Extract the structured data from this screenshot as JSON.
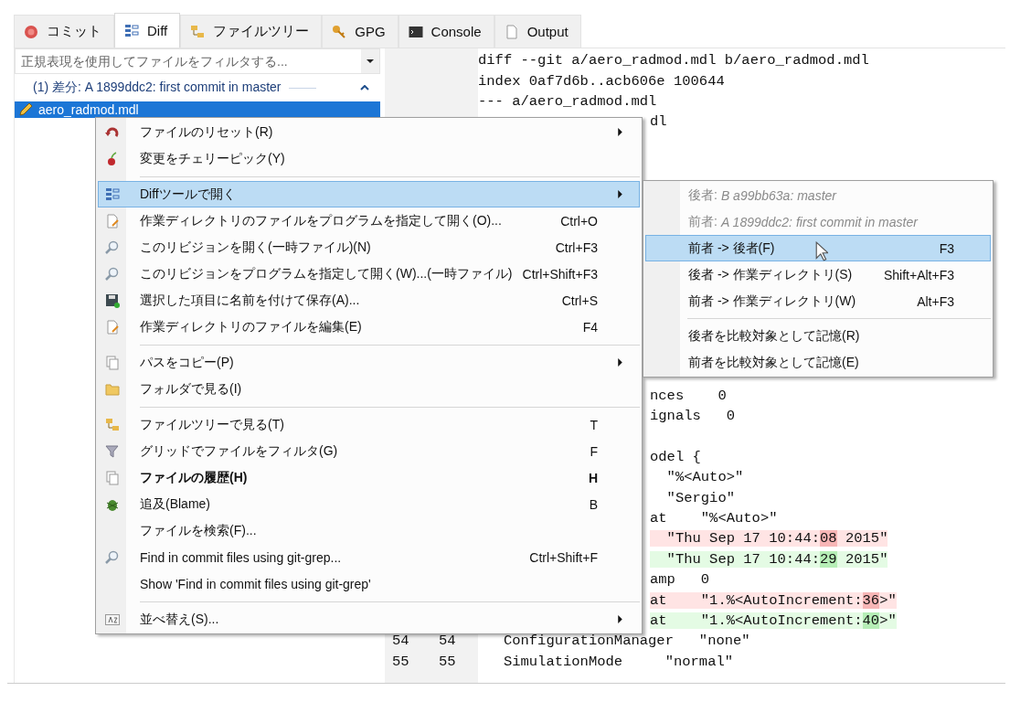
{
  "tabs": [
    {
      "label": "コミット",
      "selected": false
    },
    {
      "label": "Diff",
      "selected": true
    },
    {
      "label": "ファイルツリー",
      "selected": false
    },
    {
      "label": "GPG",
      "selected": false
    },
    {
      "label": "Console",
      "selected": false
    },
    {
      "label": "Output",
      "selected": false
    }
  ],
  "file_panel": {
    "filter": {
      "placeholder": "正規表現を使用してファイルをフィルタする..."
    },
    "group": {
      "label": "(1) 差分: A 1899ddc2: first commit in master",
      "expanded": true
    },
    "files": [
      {
        "name": "aero_radmod.mdl",
        "selected": true
      }
    ]
  },
  "diff": {
    "top_lines": [
      {
        "kind": "context",
        "clipped": false,
        "text": "diff --git a/aero_radmod.mdl b/aero_radmod.mdl"
      },
      {
        "kind": "context",
        "clipped": false,
        "text": "index 0af7d6b..acb606e 100644"
      },
      {
        "kind": "context",
        "clipped": false,
        "text": "--- a/aero_radmod.mdl"
      },
      {
        "kind": "context",
        "clipped": true,
        "text": "dl"
      }
    ],
    "middle_lines": [
      {
        "kind": "context",
        "clipped": true,
        "text": "nces    0"
      },
      {
        "kind": "context",
        "clipped": true,
        "text": "ignals   0"
      }
    ],
    "bottom_lines": [
      {
        "kind": "context",
        "clipped": true,
        "text": "odel {"
      },
      {
        "kind": "context",
        "clipped": true,
        "text": "  \"%<Auto>\""
      },
      {
        "kind": "context",
        "clipped": true,
        "text": "  \"Sergio\""
      },
      {
        "kind": "context",
        "clipped": true,
        "text": "at    \"%<Auto>\""
      },
      {
        "kind": "removed",
        "clipped": true,
        "segments": [
          {
            "text": "  \"Thu Sep 17 10:44:",
            "changed": false
          },
          {
            "text": "08",
            "changed": true
          },
          {
            "text": " 2015\"",
            "changed": false
          }
        ]
      },
      {
        "kind": "added",
        "clipped": true,
        "segments": [
          {
            "text": "  \"Thu Sep 17 10:44:",
            "changed": false
          },
          {
            "text": "29",
            "changed": true
          },
          {
            "text": " 2015\"",
            "changed": false
          }
        ]
      },
      {
        "kind": "context",
        "clipped": true,
        "text": "amp   0"
      },
      {
        "kind": "removed",
        "clipped": true,
        "segments": [
          {
            "text": "at    \"1.%<AutoIncrement:",
            "changed": false
          },
          {
            "text": "36",
            "changed": true
          },
          {
            "text": ">\"",
            "changed": false
          }
        ]
      },
      {
        "kind": "added",
        "clipped": true,
        "segments": [
          {
            "text": "at    \"1.%<AutoIncrement:",
            "changed": false
          },
          {
            "text": "40",
            "changed": true
          },
          {
            "text": ">\"",
            "changed": false
          }
        ]
      },
      {
        "kind": "context",
        "clipped": false,
        "old": "54",
        "new": "54",
        "text": "   ConfigurationManager   \"none\""
      },
      {
        "kind": "context",
        "clipped": false,
        "old": "55",
        "new": "55",
        "text": "   SimulationMode     \"normal\""
      }
    ]
  },
  "context_menu": {
    "items": [
      {
        "kind": "item",
        "label": "ファイルのリセット(R)",
        "submenu": true,
        "bold": false,
        "selected": false
      },
      {
        "kind": "item",
        "label": "変更をチェリーピック(Y)",
        "submenu": false,
        "bold": false,
        "selected": false
      },
      {
        "kind": "separator"
      },
      {
        "kind": "item",
        "label": "Diffツールで開く",
        "submenu": true,
        "bold": false,
        "selected": true
      },
      {
        "kind": "item",
        "label": "作業ディレクトリのファイルをプログラムを指定して開く(O)...",
        "shortcut": "Ctrl+O",
        "submenu": false,
        "bold": false,
        "selected": false
      },
      {
        "kind": "item",
        "label": "このリビジョンを開く(一時ファイル)(N)",
        "shortcut": "Ctrl+F3",
        "submenu": false,
        "bold": false,
        "selected": false
      },
      {
        "kind": "item",
        "label": "このリビジョンをプログラムを指定して開く(W)...(一時ファイル)",
        "shortcut": "Ctrl+Shift+F3",
        "submenu": false,
        "bold": false,
        "selected": false
      },
      {
        "kind": "item",
        "label": "選択した項目に名前を付けて保存(A)...",
        "shortcut": "Ctrl+S",
        "submenu": false,
        "bold": false,
        "selected": false
      },
      {
        "kind": "item",
        "label": "作業ディレクトリのファイルを編集(E)",
        "shortcut": "F4",
        "submenu": false,
        "bold": false,
        "selected": false
      },
      {
        "kind": "separator"
      },
      {
        "kind": "item",
        "label": "パスをコピー(P)",
        "submenu": true,
        "bold": false,
        "selected": false
      },
      {
        "kind": "item",
        "label": "フォルダで見る(I)",
        "submenu": false,
        "bold": false,
        "selected": false
      },
      {
        "kind": "separator"
      },
      {
        "kind": "item",
        "label": "ファイルツリーで見る(T)",
        "shortcut": "T",
        "submenu": false,
        "bold": false,
        "selected": false
      },
      {
        "kind": "item",
        "label": "グリッドでファイルをフィルタ(G)",
        "shortcut": "F",
        "submenu": false,
        "bold": false,
        "selected": false
      },
      {
        "kind": "item",
        "label": "ファイルの履歴(H)",
        "shortcut": "H",
        "submenu": false,
        "bold": true,
        "selected": false
      },
      {
        "kind": "item",
        "label": "追及(Blame)",
        "shortcut": "B",
        "submenu": false,
        "bold": false,
        "selected": false
      },
      {
        "kind": "item",
        "label": "ファイルを検索(F)...",
        "submenu": false,
        "bold": false,
        "selected": false
      },
      {
        "kind": "item",
        "label": "Find in commit files using git-grep...",
        "shortcut": "Ctrl+Shift+F",
        "submenu": false,
        "bold": false,
        "selected": false
      },
      {
        "kind": "item",
        "label": "Show 'Find in commit files using git-grep'",
        "submenu": false,
        "bold": false,
        "selected": false
      },
      {
        "kind": "separator"
      },
      {
        "kind": "item",
        "label": "並べ替え(S)...",
        "submenu": true,
        "bold": false,
        "selected": false
      }
    ]
  },
  "submenu": {
    "items": [
      {
        "kind": "header",
        "label": "後者:",
        "detail": "B a99bb63a: master"
      },
      {
        "kind": "header",
        "label": "前者:",
        "detail": "A 1899ddc2: first commit in master"
      },
      {
        "kind": "item",
        "label": "前者 -> 後者(F)",
        "shortcut": "F3",
        "selected": true
      },
      {
        "kind": "item",
        "label": "後者 -> 作業ディレクトリ(S)",
        "shortcut": "Shift+Alt+F3",
        "selected": false
      },
      {
        "kind": "item",
        "label": "前者 -> 作業ディレクトリ(W)",
        "shortcut": "Alt+F3",
        "selected": false
      },
      {
        "kind": "separator"
      },
      {
        "kind": "item",
        "label": "後者を比較対象として記憶(R)",
        "selected": false
      },
      {
        "kind": "item",
        "label": "前者を比較対象として記憶(E)",
        "selected": false
      }
    ]
  }
}
